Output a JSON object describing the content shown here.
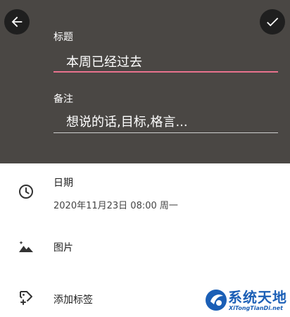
{
  "header": {
    "back_icon": "arrow-left-icon",
    "confirm_icon": "check-icon",
    "title_label": "标题",
    "title_value": "本周已经过去",
    "note_label": "备注",
    "note_placeholder": "想说的话,目标,格言..."
  },
  "date_row": {
    "icon": "clock-icon",
    "label": "日期",
    "value": "2020年11月23日 08:00 周一"
  },
  "image_row": {
    "icon": "image-icon",
    "label": "图片"
  },
  "tag_row": {
    "icon": "add-tag-icon",
    "label": "添加标签"
  },
  "watermark": {
    "title": "系统天地",
    "subtitle": "XiTongTianDi.net"
  },
  "colors": {
    "header_bg": "#4a4744",
    "accent_underline": "#e8728d",
    "watermark_blue": "#1b5fb6"
  }
}
